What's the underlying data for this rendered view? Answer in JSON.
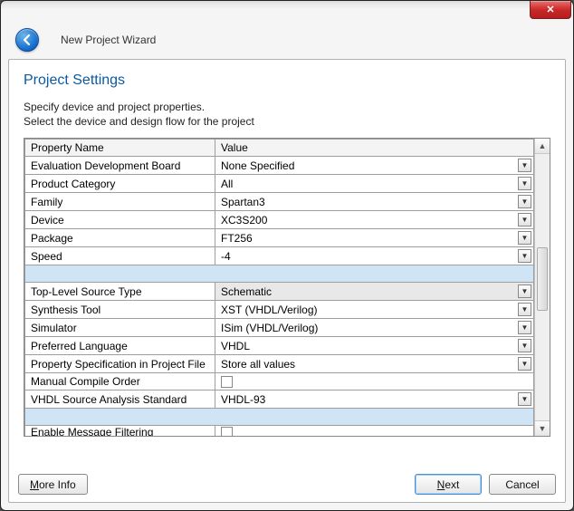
{
  "window": {
    "close_label": "✕",
    "wizard_title": "New Project Wizard"
  },
  "page": {
    "title": "Project Settings",
    "instruction_line1": "Specify device and project properties.",
    "instruction_line2": "Select the device and design flow for the project"
  },
  "grid": {
    "header_name": "Property Name",
    "header_value": "Value",
    "rows1": [
      {
        "name": "Evaluation Development Board",
        "value": "None Specified",
        "dropdown": true
      },
      {
        "name": "Product Category",
        "value": "All",
        "dropdown": true
      },
      {
        "name": "Family",
        "value": "Spartan3",
        "dropdown": true
      },
      {
        "name": "Device",
        "value": "XC3S200",
        "dropdown": true
      },
      {
        "name": "Package",
        "value": "FT256",
        "dropdown": true
      },
      {
        "name": "Speed",
        "value": "-4",
        "dropdown": true
      }
    ],
    "rows2": [
      {
        "name": "Top-Level Source Type",
        "value": "Schematic",
        "dropdown": true,
        "readonly": true
      },
      {
        "name": "Synthesis Tool",
        "value": "XST (VHDL/Verilog)",
        "dropdown": true
      },
      {
        "name": "Simulator",
        "value": "ISim (VHDL/Verilog)",
        "dropdown": true
      },
      {
        "name": "Preferred Language",
        "value": "VHDL",
        "dropdown": true
      },
      {
        "name": "Property Specification in Project File",
        "value": "Store all values",
        "dropdown": true
      },
      {
        "name": "Manual Compile Order",
        "value": "",
        "checkbox": true
      },
      {
        "name": "VHDL Source Analysis Standard",
        "value": "VHDL-93",
        "dropdown": true
      }
    ],
    "rows3": [
      {
        "name": "Enable Message Filtering",
        "value": "",
        "checkbox": true
      }
    ]
  },
  "footer": {
    "more_info": "More Info",
    "next": "Next",
    "cancel": "Cancel"
  }
}
